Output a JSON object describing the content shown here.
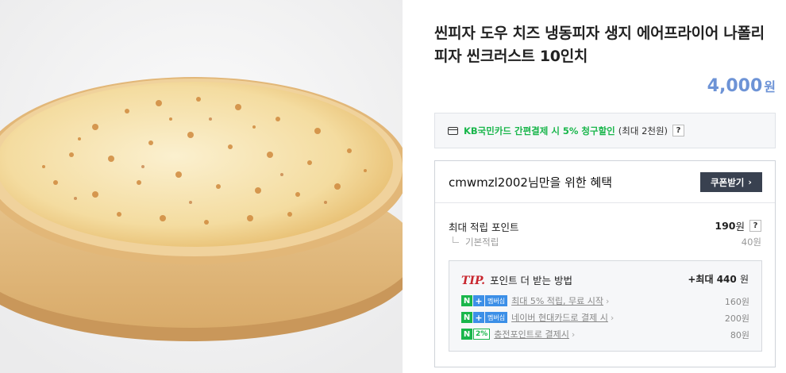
{
  "product": {
    "title": "씬피자 도우 치즈 냉동피자 생지 에어프라이어 나폴리피자 씬크러스트 10인치",
    "price": "4,000",
    "currency": "원"
  },
  "card_discount": {
    "highlight": "KB국민카드 간편결제 시 5% 청구할인",
    "note": "(최대 2천원)",
    "help": "?"
  },
  "benefit": {
    "title": "cmwmzl2002님만을 위한 혜택",
    "coupon_button": "쿠폰받기",
    "coupon_arrow": "›",
    "max_points_label": "최대 적립 포인트",
    "max_points_value": "190",
    "max_points_unit": "원",
    "max_points_help": "?",
    "base_label": "기본적립",
    "base_value": "40원"
  },
  "tip": {
    "mark": "TIP.",
    "heading": "포인트 더 받는 방법",
    "total_prefix": "+최대",
    "total_value": "440",
    "total_unit": "원",
    "rows": [
      {
        "badge_n": "N",
        "badge_plus": "+",
        "badge_text": "멤버십",
        "link": "최대 5% 적립, 무료 시작",
        "value": "160원"
      },
      {
        "badge_n": "N",
        "badge_plus": "+",
        "badge_text": "멤버십",
        "link": "네이버 현대카드로 결제 시",
        "value": "200원"
      },
      {
        "badge_n": "N",
        "badge_text": "2%",
        "link": "충전포인트로 결제시",
        "value": "80원"
      }
    ],
    "chevron": "›"
  },
  "colors": {
    "price": "#6d93d6",
    "green": "#19b64b",
    "coupon_button_bg": "#394150",
    "tip_red": "#c8262e",
    "membership_blue": "#3c8fe7"
  }
}
